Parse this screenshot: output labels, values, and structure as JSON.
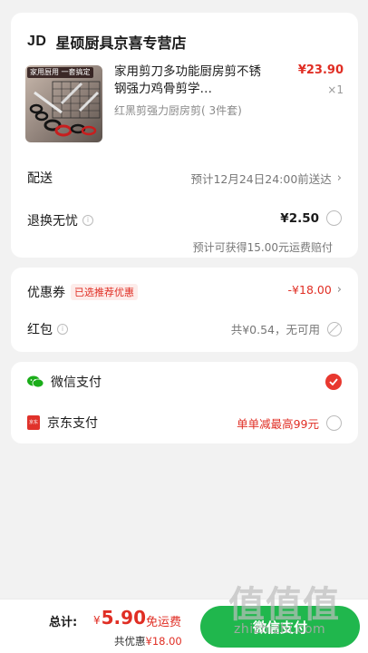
{
  "store": {
    "logo_text": "JD",
    "name": "星硕厨具京喜专营店"
  },
  "product": {
    "thumb_tag": "家用厨用 一套搞定",
    "title": "家用剪刀多功能厨房剪不锈钢强力鸡骨剪学…",
    "price": "¥23.90",
    "qty": "×1",
    "spec": "红黑剪强力厨房剪( 3件套)"
  },
  "delivery": {
    "label": "配送",
    "value": "预计12月24日24:00前送达"
  },
  "return_service": {
    "label": "退换无忧",
    "info": "i",
    "price": "¥2.50",
    "note": "预计可获得15.00元运费赔付"
  },
  "coupon": {
    "label": "优惠券",
    "badge": "已选推荐优惠",
    "value": "-¥18.00"
  },
  "red_packet": {
    "label": "红包",
    "info": "i",
    "value": "共¥0.54，无可用"
  },
  "payment": {
    "wechat_label": "微信支付",
    "jd_label": "京东支付",
    "jd_promo": "单单减最高99元",
    "jd_icon_text": "京东"
  },
  "icons": {
    "chevron": "›",
    "check": "✓"
  },
  "bottom": {
    "total_label": "总计:",
    "currency": "¥",
    "total_amount": "5.90",
    "free_shipping": "免运费",
    "saving_prefix": "共优惠",
    "saving_amount": "¥18.00",
    "pay_button": "微信支付"
  },
  "watermark": {
    "text": "值值值",
    "url": "zhizhizhi.com"
  },
  "colors": {
    "accent_red": "#e02e24",
    "pay_green": "#20b74d",
    "wechat_green": "#1aad19",
    "jd_red": "#e0322b"
  }
}
